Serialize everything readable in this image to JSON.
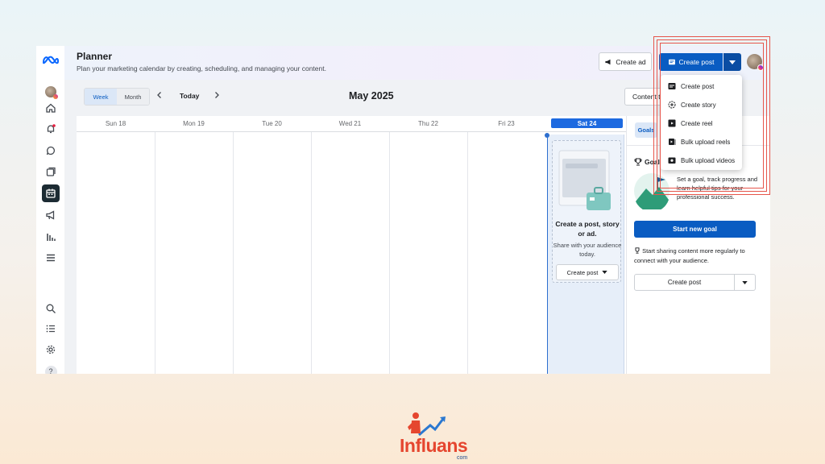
{
  "header": {
    "title": "Planner",
    "subtitle": "Plan your marketing calendar by creating, scheduling, and managing your content.",
    "create_ad_label": "Create ad",
    "create_post_label": "Create post"
  },
  "toolbar": {
    "view_week": "Week",
    "view_month": "Month",
    "today_label": "Today",
    "month_label": "May 2025",
    "content_type_label": "Content type: all"
  },
  "calendar": {
    "days": [
      "Sun 18",
      "Mon 19",
      "Tue 20",
      "Wed 21",
      "Thu 22",
      "Fri 23",
      "Sat 24"
    ],
    "empty_title": "Create a post, story or ad.",
    "empty_subtitle": "Share with your audience today.",
    "empty_button": "Create post"
  },
  "dropdown": {
    "items": [
      {
        "label": "Create post",
        "icon": "post-icon"
      },
      {
        "label": "Create story",
        "icon": "story-icon"
      },
      {
        "label": "Create reel",
        "icon": "reel-icon"
      },
      {
        "label": "Bulk upload reels",
        "icon": "bulk-reels-icon"
      },
      {
        "label": "Bulk upload videos",
        "icon": "bulk-videos-icon"
      }
    ]
  },
  "right_panel": {
    "tab_goals": "Goals",
    "goal_title": "Goal",
    "goal_desc": "Set a goal, track progress and learn helpful tips for your professional success.",
    "start_goal": "Start new goal",
    "share_text": "Start sharing content more regularly to connect with your audience.",
    "create_post": "Create post"
  },
  "brand": {
    "name": "Influans",
    "domain": "com"
  },
  "colors": {
    "primary": "#0a5cc2",
    "selected_day": "#1d6ae0",
    "highlight": "#e6554b",
    "brand": "#e5462f"
  }
}
